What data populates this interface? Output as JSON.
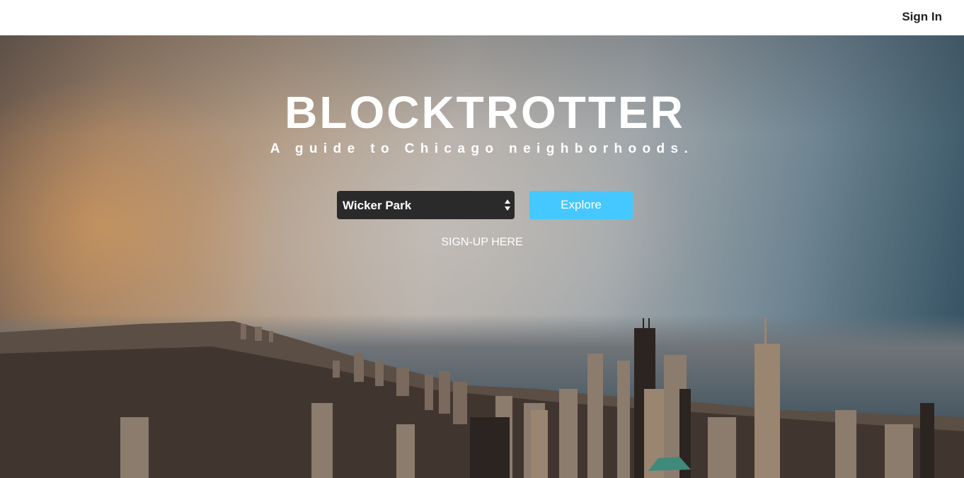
{
  "header": {
    "signin_label": "Sign In"
  },
  "hero": {
    "title": "BLOCKTROTTER",
    "subtitle": "A guide to Chicago neighborhoods.",
    "neighborhood_select": {
      "selected": "Wicker Park"
    },
    "explore_label": "Explore",
    "signup_label": "SIGN-UP HERE"
  },
  "colors": {
    "explore_button": "#45c8ff",
    "select_background": "#2a2a2a",
    "text": "#ffffff"
  }
}
